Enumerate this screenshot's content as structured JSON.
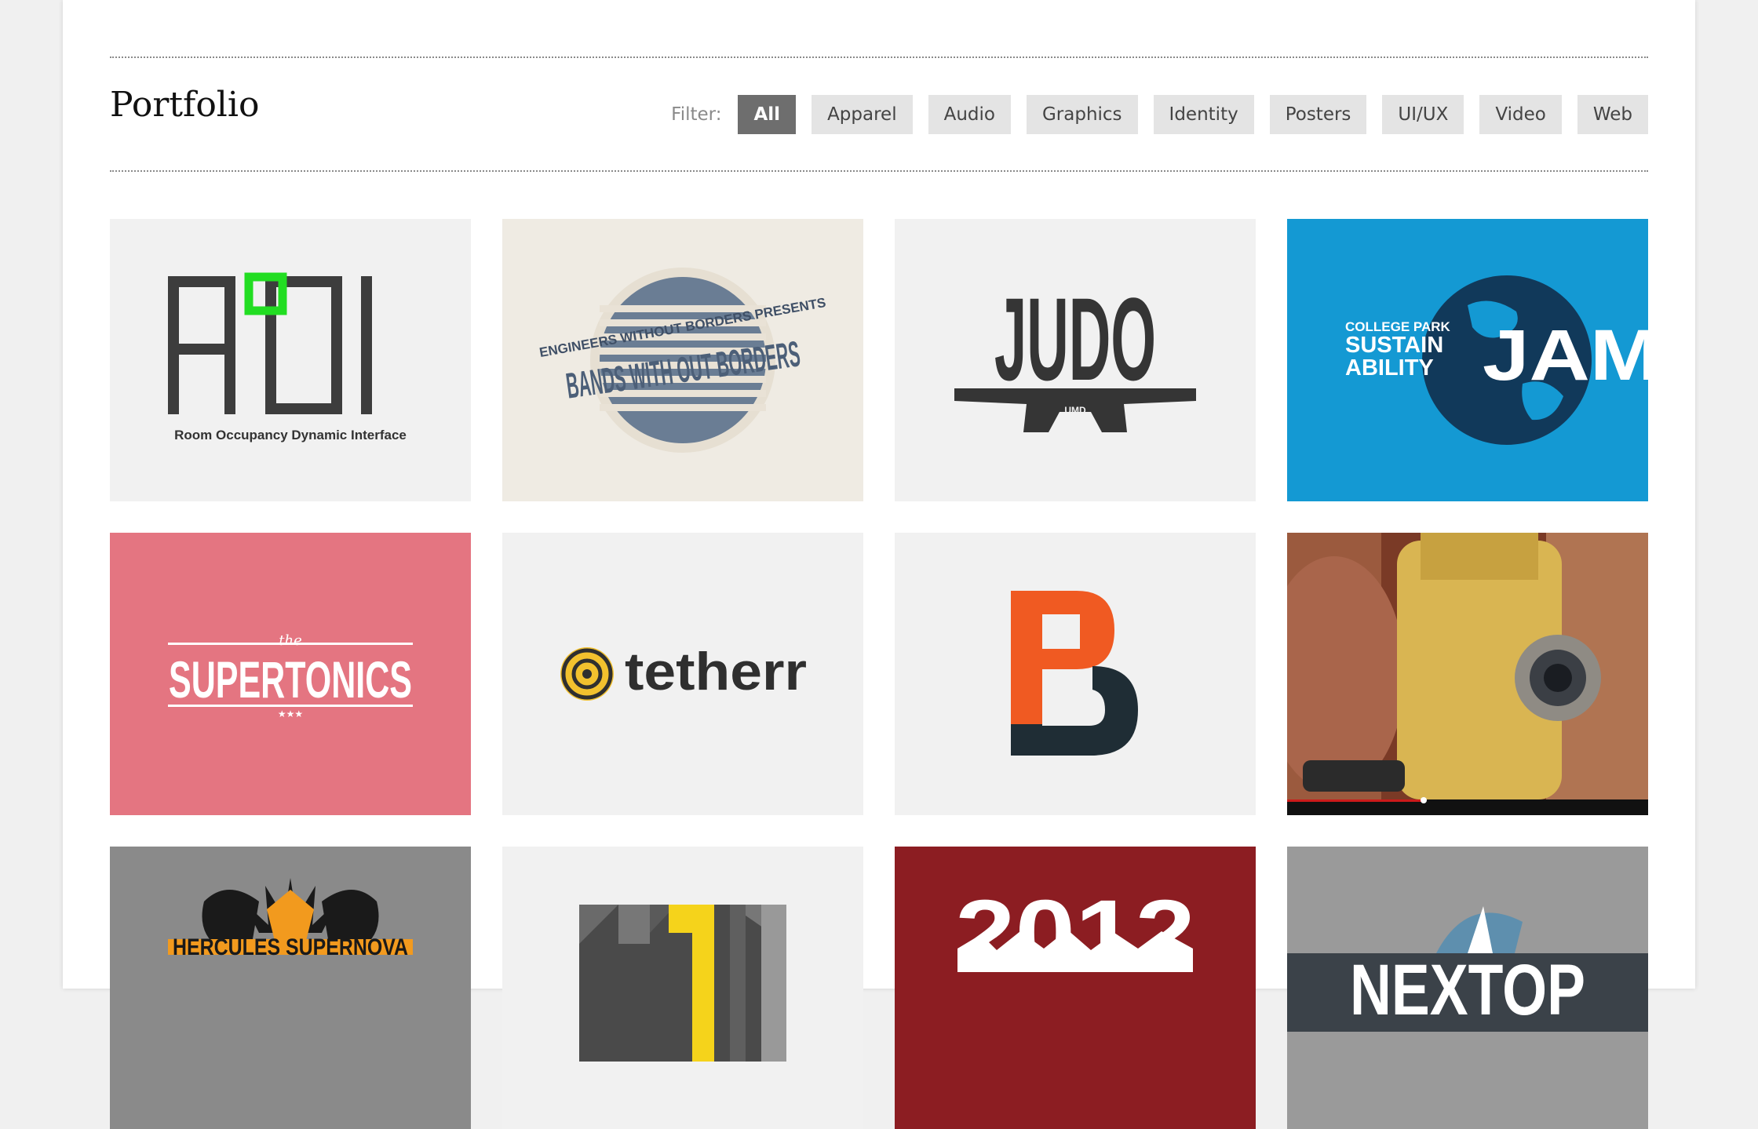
{
  "header": {
    "title": "Portfolio",
    "filter_label": "Filter:",
    "filters": [
      {
        "label": "All",
        "active": true
      },
      {
        "label": "Apparel",
        "active": false
      },
      {
        "label": "Audio",
        "active": false
      },
      {
        "label": "Graphics",
        "active": false
      },
      {
        "label": "Identity",
        "active": false
      },
      {
        "label": "Posters",
        "active": false
      },
      {
        "label": "UI/UX",
        "active": false
      },
      {
        "label": "Video",
        "active": false
      },
      {
        "label": "Web",
        "active": false
      }
    ]
  },
  "colors": {
    "active_filter_bg": "#6e6e6e",
    "filter_bg": "#e4e4e4",
    "rodi_green": "#22dd22",
    "jam_blue": "#1499d3",
    "supertonics_pink": "#e47581",
    "tetherr_yellow": "#f2c12e",
    "pb_orange": "#f05a22",
    "poster_red": "#8c1d22"
  },
  "tiles": [
    {
      "name": "rodi",
      "logo_text": "R°DI",
      "caption": "Room Occupancy Dynamic Interface"
    },
    {
      "name": "bands-without-borders",
      "logo_text": "BANDS WITH OUT BORDERS",
      "top_text": "ENGINEERS WITHOUT BORDERS PRESENTS"
    },
    {
      "name": "judo",
      "logo_text": "JUDO",
      "belt_text": "UMD"
    },
    {
      "name": "sustainability-jam",
      "logo_text": "JAM",
      "line1": "COLLEGE PARK",
      "line2": "SUSTAIN",
      "line3": "ABILITY"
    },
    {
      "name": "supertonics",
      "small_text": "the",
      "logo_text": "SUPERTONICS",
      "stars": "★★★"
    },
    {
      "name": "tetherr",
      "logo_text": "tetherr"
    },
    {
      "name": "pb-monogram",
      "logo_text": "PB"
    },
    {
      "name": "video-surveyor"
    },
    {
      "name": "hercules-supernova",
      "logo_text": "HERCULES SUPERNOVA"
    },
    {
      "name": "maryland-flag"
    },
    {
      "name": "2012-poster",
      "logo_text": "2012"
    },
    {
      "name": "nextop",
      "logo_text": "NEXTOP"
    }
  ]
}
